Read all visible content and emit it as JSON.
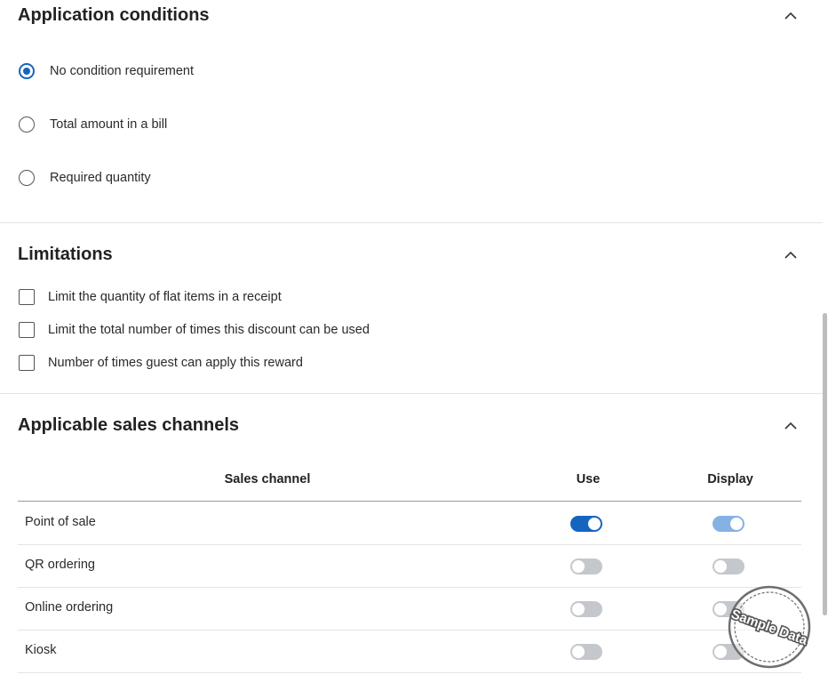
{
  "application_conditions": {
    "title": "Application conditions",
    "options": [
      {
        "label": "No condition requirement",
        "selected": true
      },
      {
        "label": "Total amount in a bill",
        "selected": false
      },
      {
        "label": "Required quantity",
        "selected": false
      }
    ]
  },
  "limitations": {
    "title": "Limitations",
    "options": [
      {
        "label": "Limit the quantity of flat items in a receipt",
        "checked": false
      },
      {
        "label": "Limit the total number of times this discount can be used",
        "checked": false
      },
      {
        "label": "Number of times guest can apply this reward",
        "checked": false
      }
    ]
  },
  "sales_channels": {
    "title": "Applicable sales channels",
    "columns": {
      "channel": "Sales channel",
      "use": "Use",
      "display": "Display"
    },
    "rows": [
      {
        "label": "Point of sale",
        "use": true,
        "display": true
      },
      {
        "label": "QR ordering",
        "use": false,
        "display": false
      },
      {
        "label": "Online ordering",
        "use": false,
        "display": false
      },
      {
        "label": "Kiosk",
        "use": false,
        "display": false
      }
    ]
  },
  "watermark": {
    "text": "Sample Data"
  },
  "colors": {
    "accent": "#1565c0",
    "accent_soft": "#86b2e3",
    "toggle_off": "#c4c8cc",
    "divider": "#e3e3e3"
  },
  "icons": {
    "collapse": "chevron-up-icon"
  }
}
